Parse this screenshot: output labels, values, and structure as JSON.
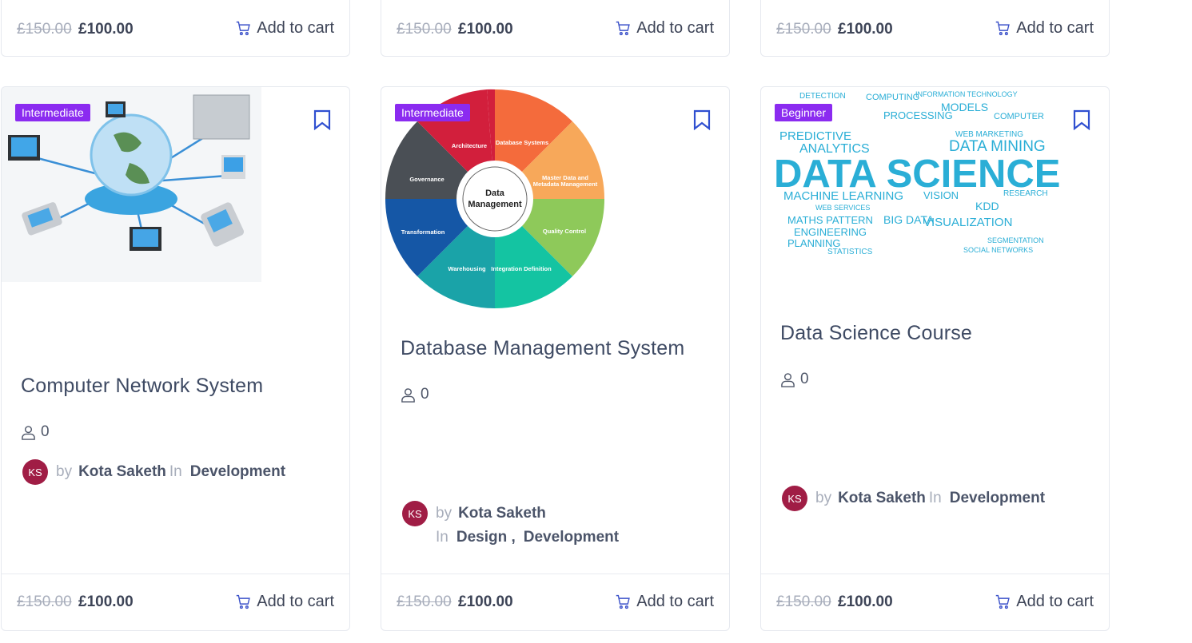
{
  "currency_old": "£150.00",
  "currency_new": "£100.00",
  "cart_label": "Add to cart",
  "top_cards": [
    {
      "old_price": "£150.00",
      "new_price": "£100.00",
      "cart": "Add to cart"
    },
    {
      "old_price": "£150.00",
      "new_price": "£100.00",
      "cart": "Add to cart"
    },
    {
      "old_price": "£150.00",
      "new_price": "£100.00",
      "cart": "Add to cart"
    }
  ],
  "courses": [
    {
      "badge": "Intermediate",
      "title": "Computer Network System",
      "enrolled": "0",
      "avatar": "KS",
      "by": "by",
      "author": "Kota Saketh",
      "in": "In",
      "categories": "Development",
      "old_price": "£150.00",
      "new_price": "£100.00",
      "cart": "Add to cart"
    },
    {
      "badge": "Intermediate",
      "title": "Database Management System",
      "enrolled": "0",
      "avatar": "KS",
      "by": "by",
      "author": "Kota Saketh",
      "in": "In",
      "cat1": "Design ,",
      "cat2": "Development",
      "old_price": "£150.00",
      "new_price": "£100.00",
      "cart": "Add to cart",
      "wheel": {
        "center": "Data Management",
        "segments": [
          "Architecture",
          "Database Systems",
          "Master Data and Metadata Management",
          "Quality Control",
          "Integration Definition",
          "Warehousing",
          "Transformation",
          "Governance"
        ]
      }
    },
    {
      "badge": "Beginner",
      "title": "Data Science Course",
      "enrolled": "0",
      "avatar": "KS",
      "by": "by",
      "author": "Kota Saketh",
      "in": "In",
      "categories": "Development",
      "old_price": "£150.00",
      "new_price": "£100.00",
      "cart": "Add to cart",
      "cloud": {
        "headline": "DATA SCIENCE",
        "words": [
          "DETECTION",
          "COMPUTING",
          "INFORMATION TECHNOLOGY",
          "MODELS",
          "PROCESSING",
          "COMPUTER",
          "PREDICTIVE",
          "DATA MINING",
          "ANALYTICS",
          "MACHINE LEARNING",
          "VISION",
          "RESEARCH",
          "KDD",
          "MATHS PATTERN",
          "ENGINEERING",
          "BIG DATA",
          "VISUALIZATION",
          "PLANNING",
          "STATISTICS",
          "SEGMENTATION",
          "SOCIAL NETWORKS",
          "WEB SERVICES",
          "WEB MARKETING"
        ]
      }
    }
  ],
  "colors": {
    "badge": "#8b2bf0",
    "avatar": "#a01d45",
    "bookmark": "#2f4fd0",
    "cart_icon": "#3c52c9"
  }
}
